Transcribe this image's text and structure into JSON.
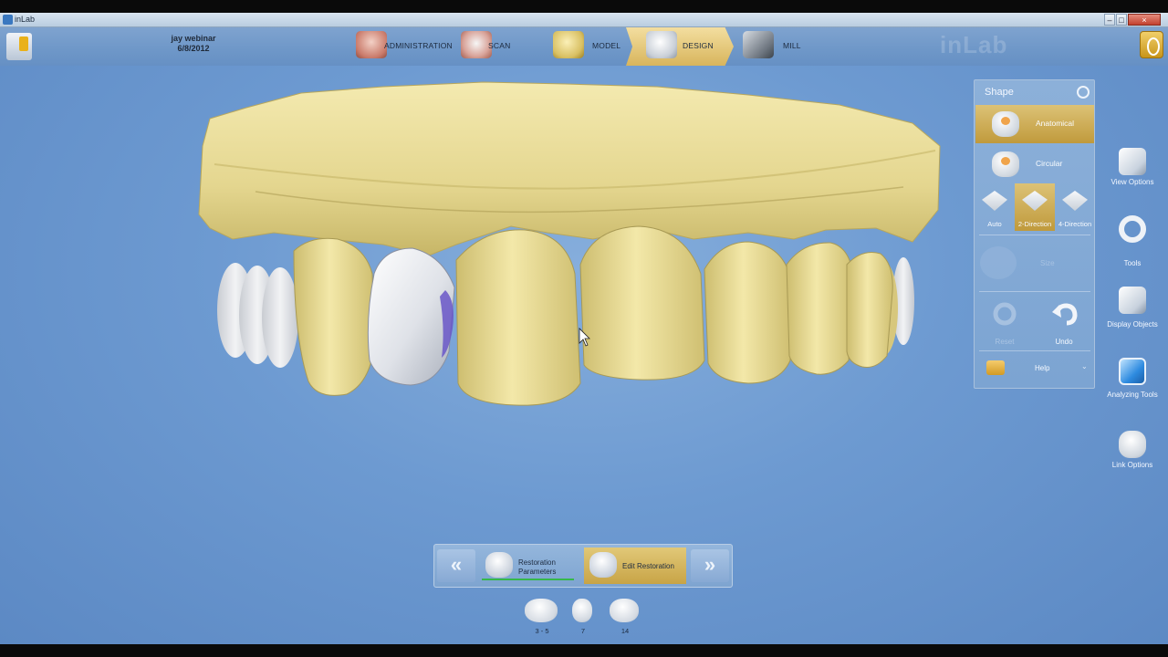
{
  "window": {
    "title": "inLab",
    "minimize": "–",
    "maximize": "□",
    "close": "×"
  },
  "case": {
    "name": "jay webinar",
    "date": "6/8/2012"
  },
  "steps": {
    "administration": "ADMINISTRATION",
    "scan": "SCAN",
    "model": "MODEL",
    "design": "DESIGN",
    "mill": "MILL"
  },
  "brand_watermark": "inLab",
  "shape_panel": {
    "title": "Shape",
    "anatomical": "Anatomical",
    "circular": "Circular",
    "auto": "Auto",
    "two_direction": "2-Direction",
    "four_direction": "4-Direction",
    "size": "Size",
    "reset": "Reset",
    "undo": "Undo",
    "help": "Help"
  },
  "side_tools": {
    "view_options": "View Options",
    "tools": "Tools",
    "display_objects": "Display Objects",
    "analyzing_tools": "Analyzing Tools",
    "link_options": "Link Options"
  },
  "phase_bar": {
    "prev_arrow": "«",
    "next_arrow": "»",
    "restoration_parameters_1": "Restoration",
    "restoration_parameters_2": "Parameters",
    "edit_restoration": "Edit Restoration"
  },
  "tooth_selector": [
    {
      "label": "3 - 5"
    },
    {
      "label": "7"
    },
    {
      "label": "14"
    }
  ],
  "colors": {
    "model_yellow": "#e9dc95",
    "active_gold": "#d8b55c",
    "background_blue": "#6d9ad1",
    "restoration_white": "#e6e9ef"
  }
}
